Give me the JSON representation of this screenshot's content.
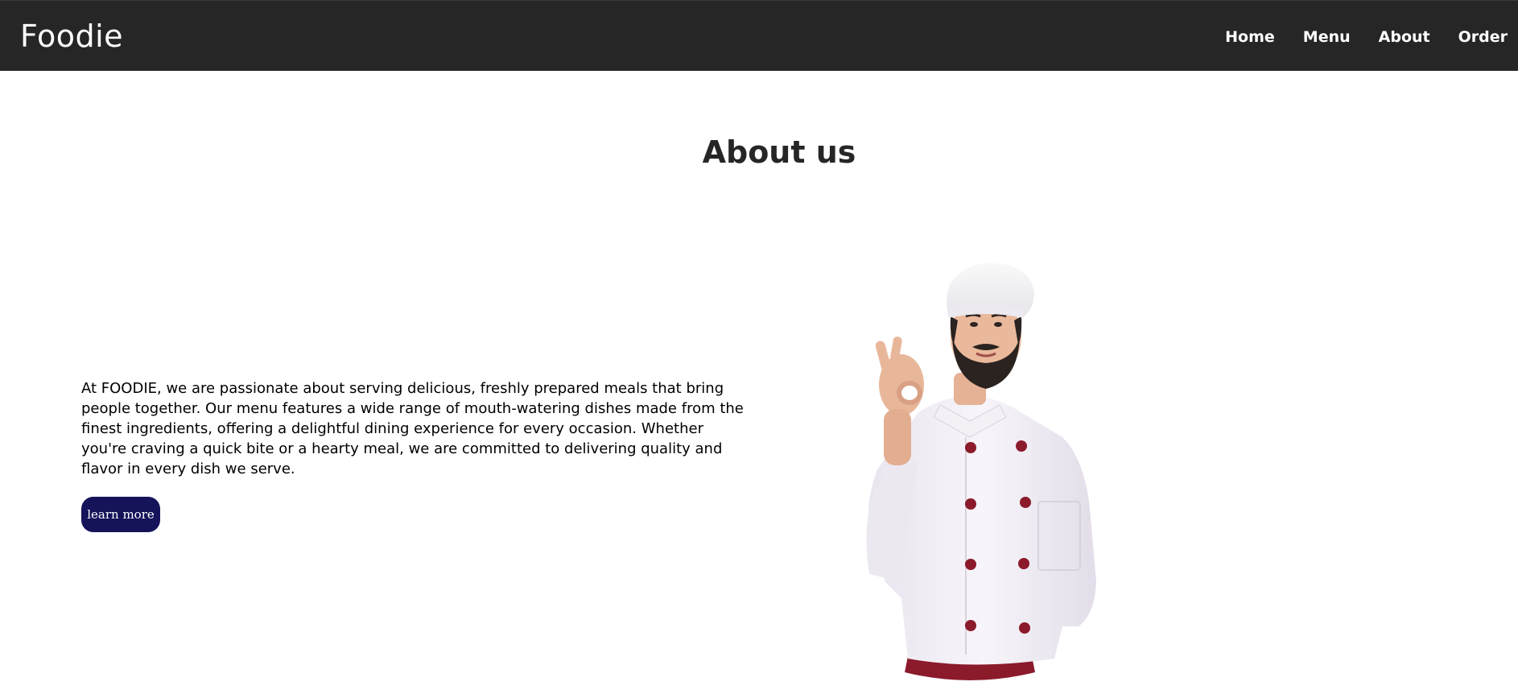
{
  "brand": "Foodie",
  "nav": {
    "items": [
      "Home",
      "Menu",
      "About",
      "Order"
    ]
  },
  "about": {
    "title": "About us",
    "paragraph": "At FOODIE, we are passionate about serving delicious, freshly prepared meals that bring people together. Our menu features a wide range of mouth-watering dishes made from the finest ingredients, offering a delightful dining experience for every occasion. Whether you're craving a quick bite or a hearty meal, we are committed to delivering quality and flavor in every dish we serve.",
    "button_label": "learn more"
  },
  "colors": {
    "navbar_bg": "#262626",
    "button_bg": "#15135a",
    "title_text": "#262626",
    "chef_buttons": "#8b1a2b"
  },
  "icons": {
    "chef_image": "chef-ok-gesture-image"
  }
}
